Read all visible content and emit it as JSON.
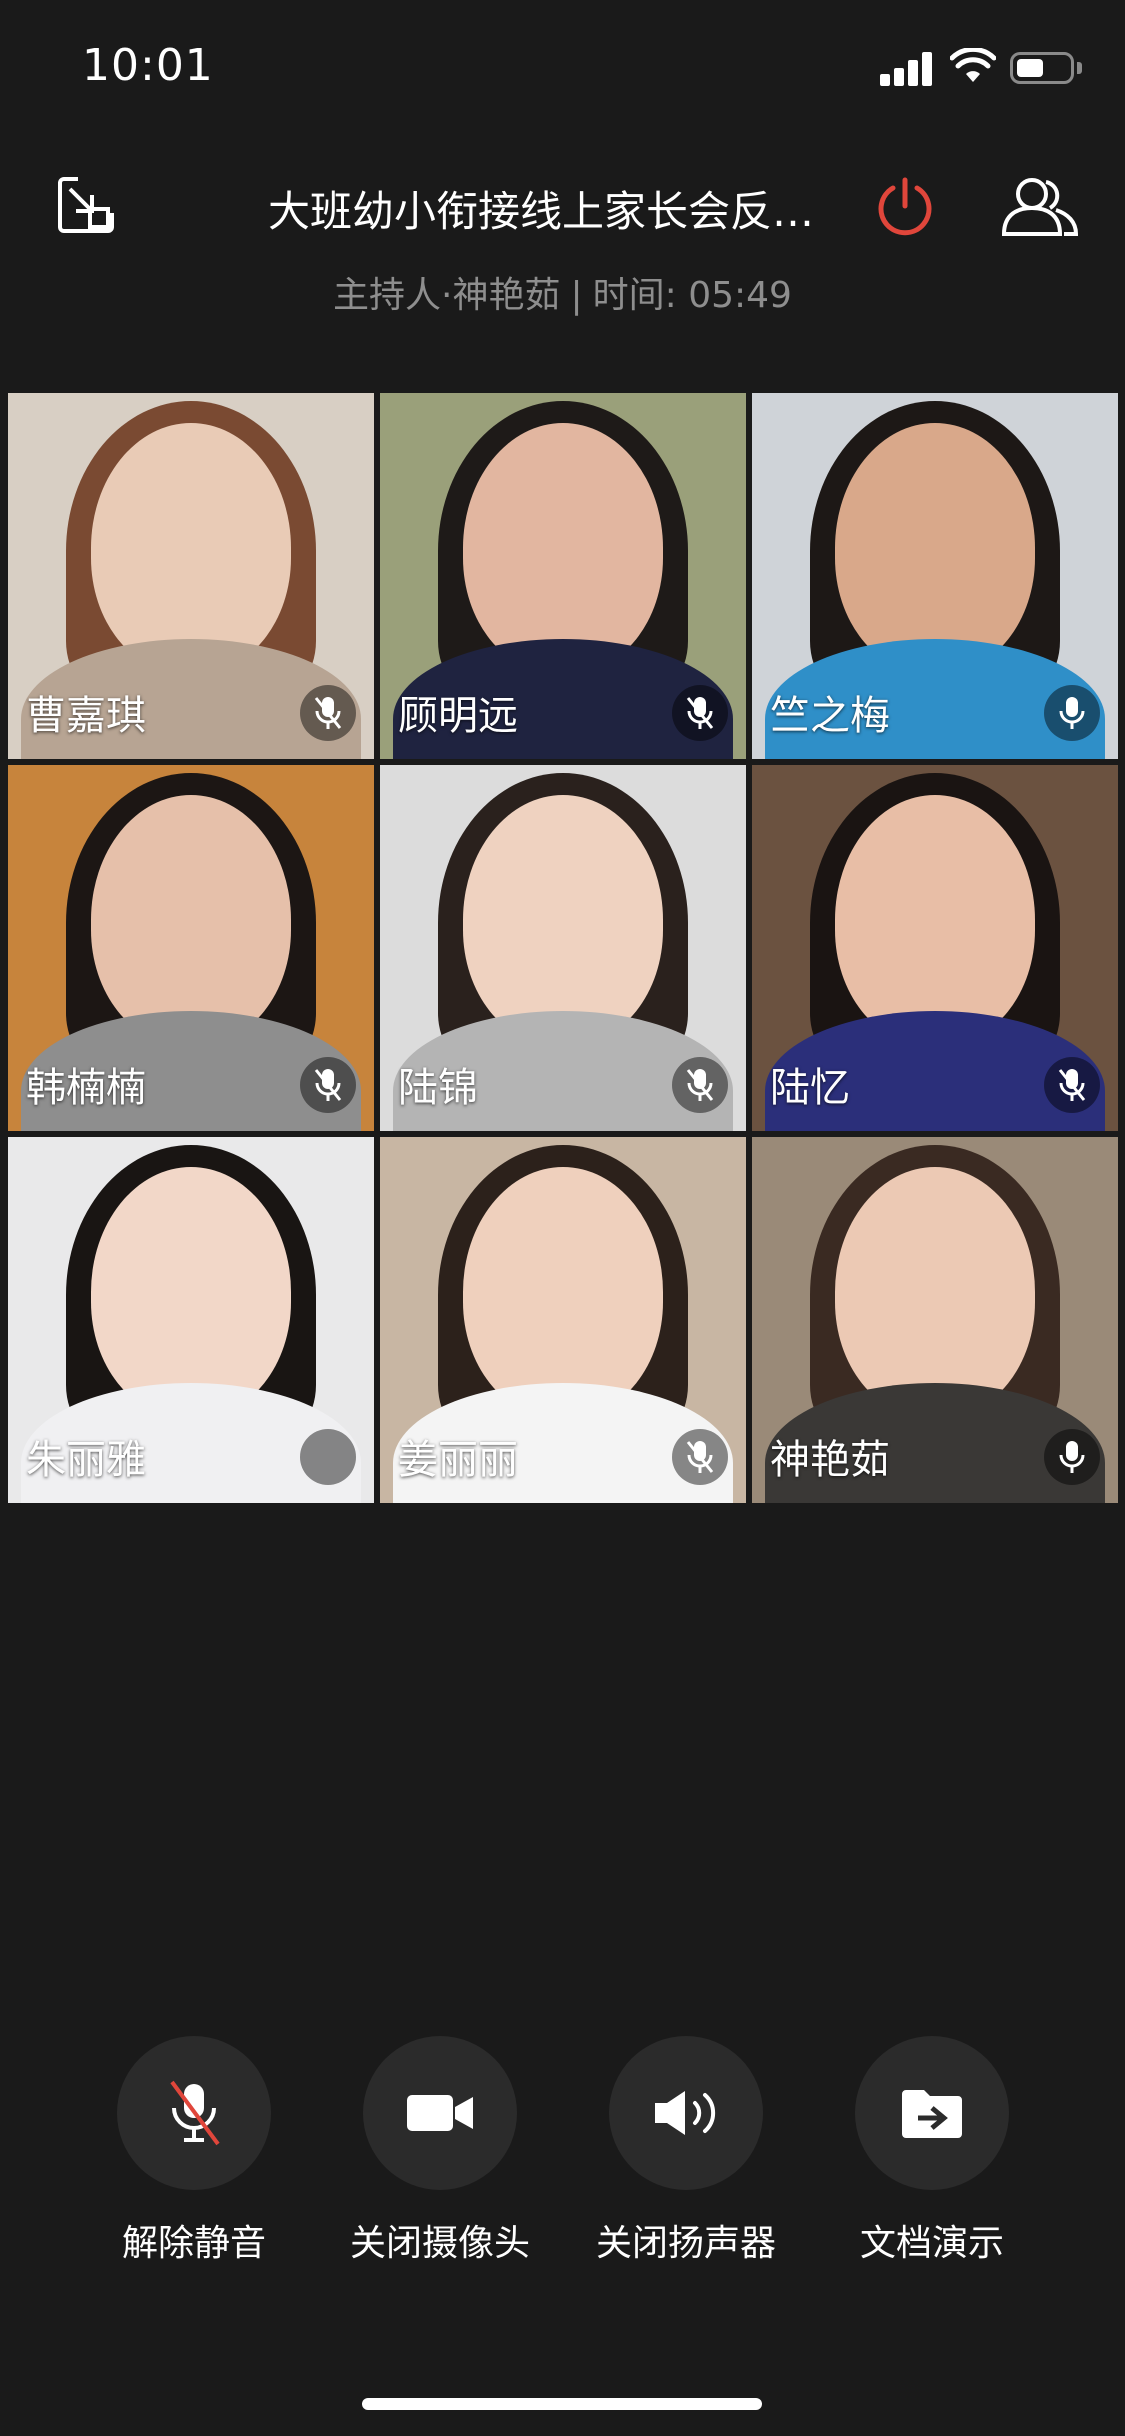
{
  "status_bar": {
    "time": "10:01"
  },
  "header": {
    "title": "大班幼小衔接线上家长会反…",
    "host_label": "主持人·神艳茹",
    "separator": "|",
    "timer": "时间: 05:49"
  },
  "participants": [
    {
      "name": "曹嘉琪",
      "mic": "muted"
    },
    {
      "name": "顾明远",
      "mic": "muted"
    },
    {
      "name": "竺之梅",
      "mic": "on"
    },
    {
      "name": "韩楠楠",
      "mic": "muted"
    },
    {
      "name": "陆锦",
      "mic": "muted"
    },
    {
      "name": "陆忆",
      "mic": "muted"
    },
    {
      "name": "朱丽雅",
      "mic": "speaking"
    },
    {
      "name": "姜丽丽",
      "mic": "muted"
    },
    {
      "name": "神艳茹",
      "mic": "on"
    }
  ],
  "controls": {
    "unmute": "解除静音",
    "camera_off": "关闭摄像头",
    "speaker_off": "关闭扬声器",
    "doc_present": "文档演示"
  },
  "colors": {
    "background": "#1a1a1a",
    "control_circle": "#2b2b2b",
    "leave_red": "#e0463b",
    "muted_slash": "#e0463b",
    "meta_text": "#8e8e8e"
  },
  "icons": {
    "shrink": "shrink-window-icon",
    "leave": "power-icon",
    "members": "members-icon",
    "mic": "microphone-icon",
    "camera": "video-camera-icon",
    "speaker": "speaker-icon",
    "doc": "folder-share-icon"
  }
}
